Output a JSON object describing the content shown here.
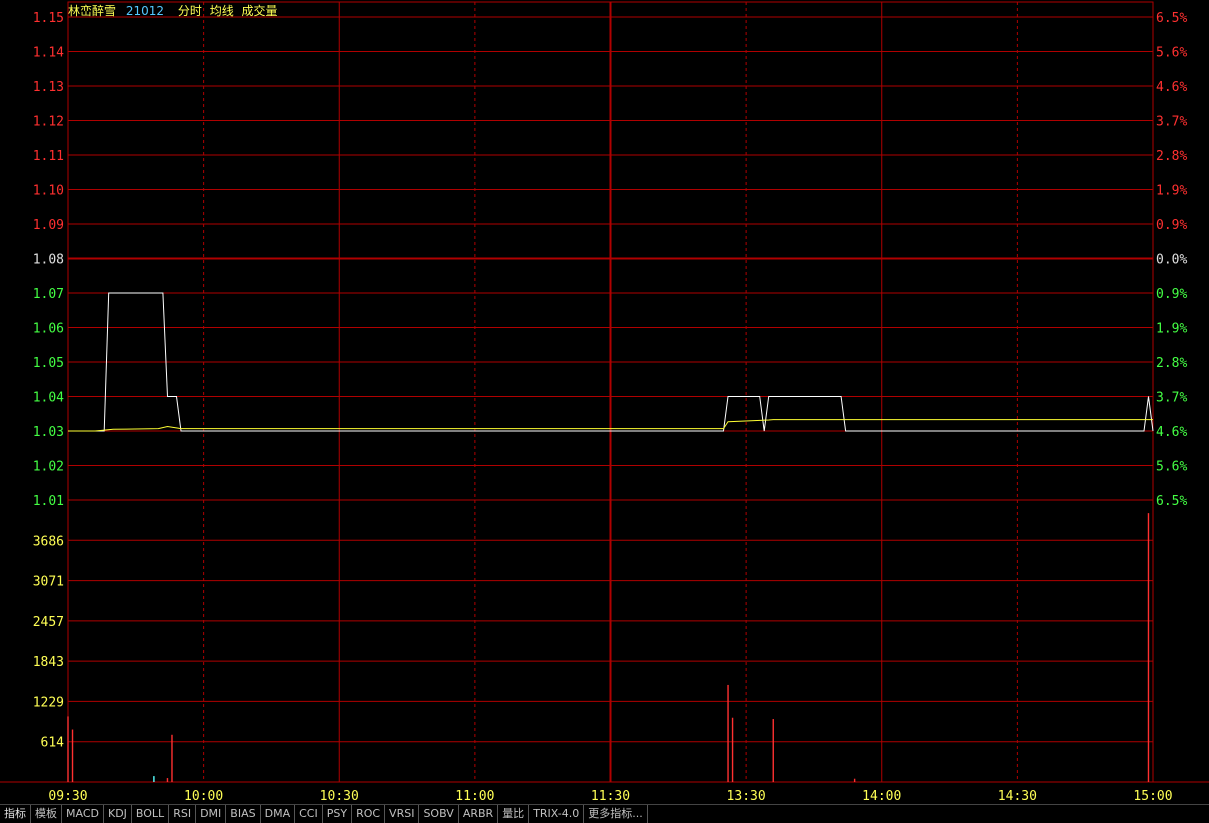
{
  "header": {
    "name": "林峦醉雪",
    "code": "21012",
    "menu": [
      "分时",
      "均线",
      "成交量"
    ]
  },
  "tabs": [
    "指标",
    "模板",
    "MACD",
    "KDJ",
    "BOLL",
    "RSI",
    "DMI",
    "BIAS",
    "DMA",
    "CCI",
    "PSY",
    "ROC",
    "VRSI",
    "SOBV",
    "ARBR",
    "量比",
    "TRIX-4.0",
    "更多指标..."
  ],
  "colors": {
    "grid": "#b00000",
    "up": "#ff3030",
    "down": "#44ff44",
    "flat": "#e0e0e0",
    "volume_axis": "#ffff55",
    "price_line": "#ffffff",
    "avg_line": "#ffff33",
    "volume_up": "#ff3030",
    "volume_down": "#55ffff"
  },
  "chart_data": {
    "type": "line",
    "subtype": "intraday-time-share",
    "prev_close": 1.08,
    "price_axis": {
      "ylim": [
        1.01,
        1.15
      ],
      "ticks": [
        "1.15",
        "1.14",
        "1.13",
        "1.12",
        "1.11",
        "1.10",
        "1.09",
        "1.08",
        "1.07",
        "1.06",
        "1.05",
        "1.04",
        "1.03",
        "1.02",
        "1.01"
      ]
    },
    "pct_axis": {
      "ticks": [
        "6.5%",
        "5.6%",
        "4.6%",
        "3.7%",
        "2.8%",
        "1.9%",
        "0.9%",
        "0.0%",
        "0.9%",
        "1.9%",
        "2.8%",
        "3.7%",
        "4.6%",
        "5.6%",
        "6.5%"
      ]
    },
    "volume_axis": {
      "ylim": [
        0,
        4300
      ],
      "ticks": [
        "3686",
        "3071",
        "2457",
        "1843",
        "1229",
        "614"
      ]
    },
    "x_ticks": [
      "09:30",
      "10:00",
      "10:30",
      "11:00",
      "11:30",
      "13:30",
      "14:00",
      "14:30",
      "15:00"
    ],
    "sessions": [
      {
        "start": "09:30",
        "end": "11:30"
      },
      {
        "start": "13:00",
        "end": "15:00"
      }
    ],
    "series": [
      {
        "kind": "price",
        "points": [
          [
            "09:30",
            1.03
          ],
          [
            "09:38",
            1.03
          ],
          [
            "09:39",
            1.07
          ],
          [
            "09:51",
            1.07
          ],
          [
            "09:52",
            1.04
          ],
          [
            "09:54",
            1.04
          ],
          [
            "09:55",
            1.03
          ],
          [
            "11:30",
            1.03
          ],
          [
            "13:00",
            1.03
          ],
          [
            "13:25",
            1.03
          ],
          [
            "13:26",
            1.04
          ],
          [
            "13:33",
            1.04
          ],
          [
            "13:34",
            1.03
          ],
          [
            "13:35",
            1.04
          ],
          [
            "13:51",
            1.04
          ],
          [
            "13:52",
            1.03
          ],
          [
            "14:58",
            1.03
          ],
          [
            "14:59",
            1.04
          ],
          [
            "15:00",
            1.03
          ]
        ]
      },
      {
        "kind": "average",
        "points": [
          [
            "09:30",
            1.03
          ],
          [
            "09:36",
            1.03
          ],
          [
            "09:40",
            1.0305
          ],
          [
            "09:50",
            1.0307
          ],
          [
            "09:52",
            1.0313
          ],
          [
            "09:55",
            1.0307
          ],
          [
            "11:30",
            1.0307
          ],
          [
            "13:00",
            1.0307
          ],
          [
            "13:25",
            1.0307
          ],
          [
            "13:26",
            1.0327
          ],
          [
            "13:35",
            1.0332
          ],
          [
            "13:36",
            1.0333
          ],
          [
            "13:50",
            1.0333
          ],
          [
            "15:00",
            1.0333
          ]
        ]
      }
    ],
    "volume": [
      {
        "t": "09:30",
        "v": 1000,
        "dir": "up"
      },
      {
        "t": "09:31",
        "v": 800,
        "dir": "up"
      },
      {
        "t": "09:49",
        "v": 90,
        "dir": "down"
      },
      {
        "t": "09:52",
        "v": 60,
        "dir": "up"
      },
      {
        "t": "09:53",
        "v": 720,
        "dir": "up"
      },
      {
        "t": "13:26",
        "v": 1480,
        "dir": "up"
      },
      {
        "t": "13:27",
        "v": 980,
        "dir": "up"
      },
      {
        "t": "13:36",
        "v": 960,
        "dir": "up"
      },
      {
        "t": "13:54",
        "v": 50,
        "dir": "up"
      },
      {
        "t": "14:59",
        "v": 4100,
        "dir": "up"
      }
    ]
  }
}
